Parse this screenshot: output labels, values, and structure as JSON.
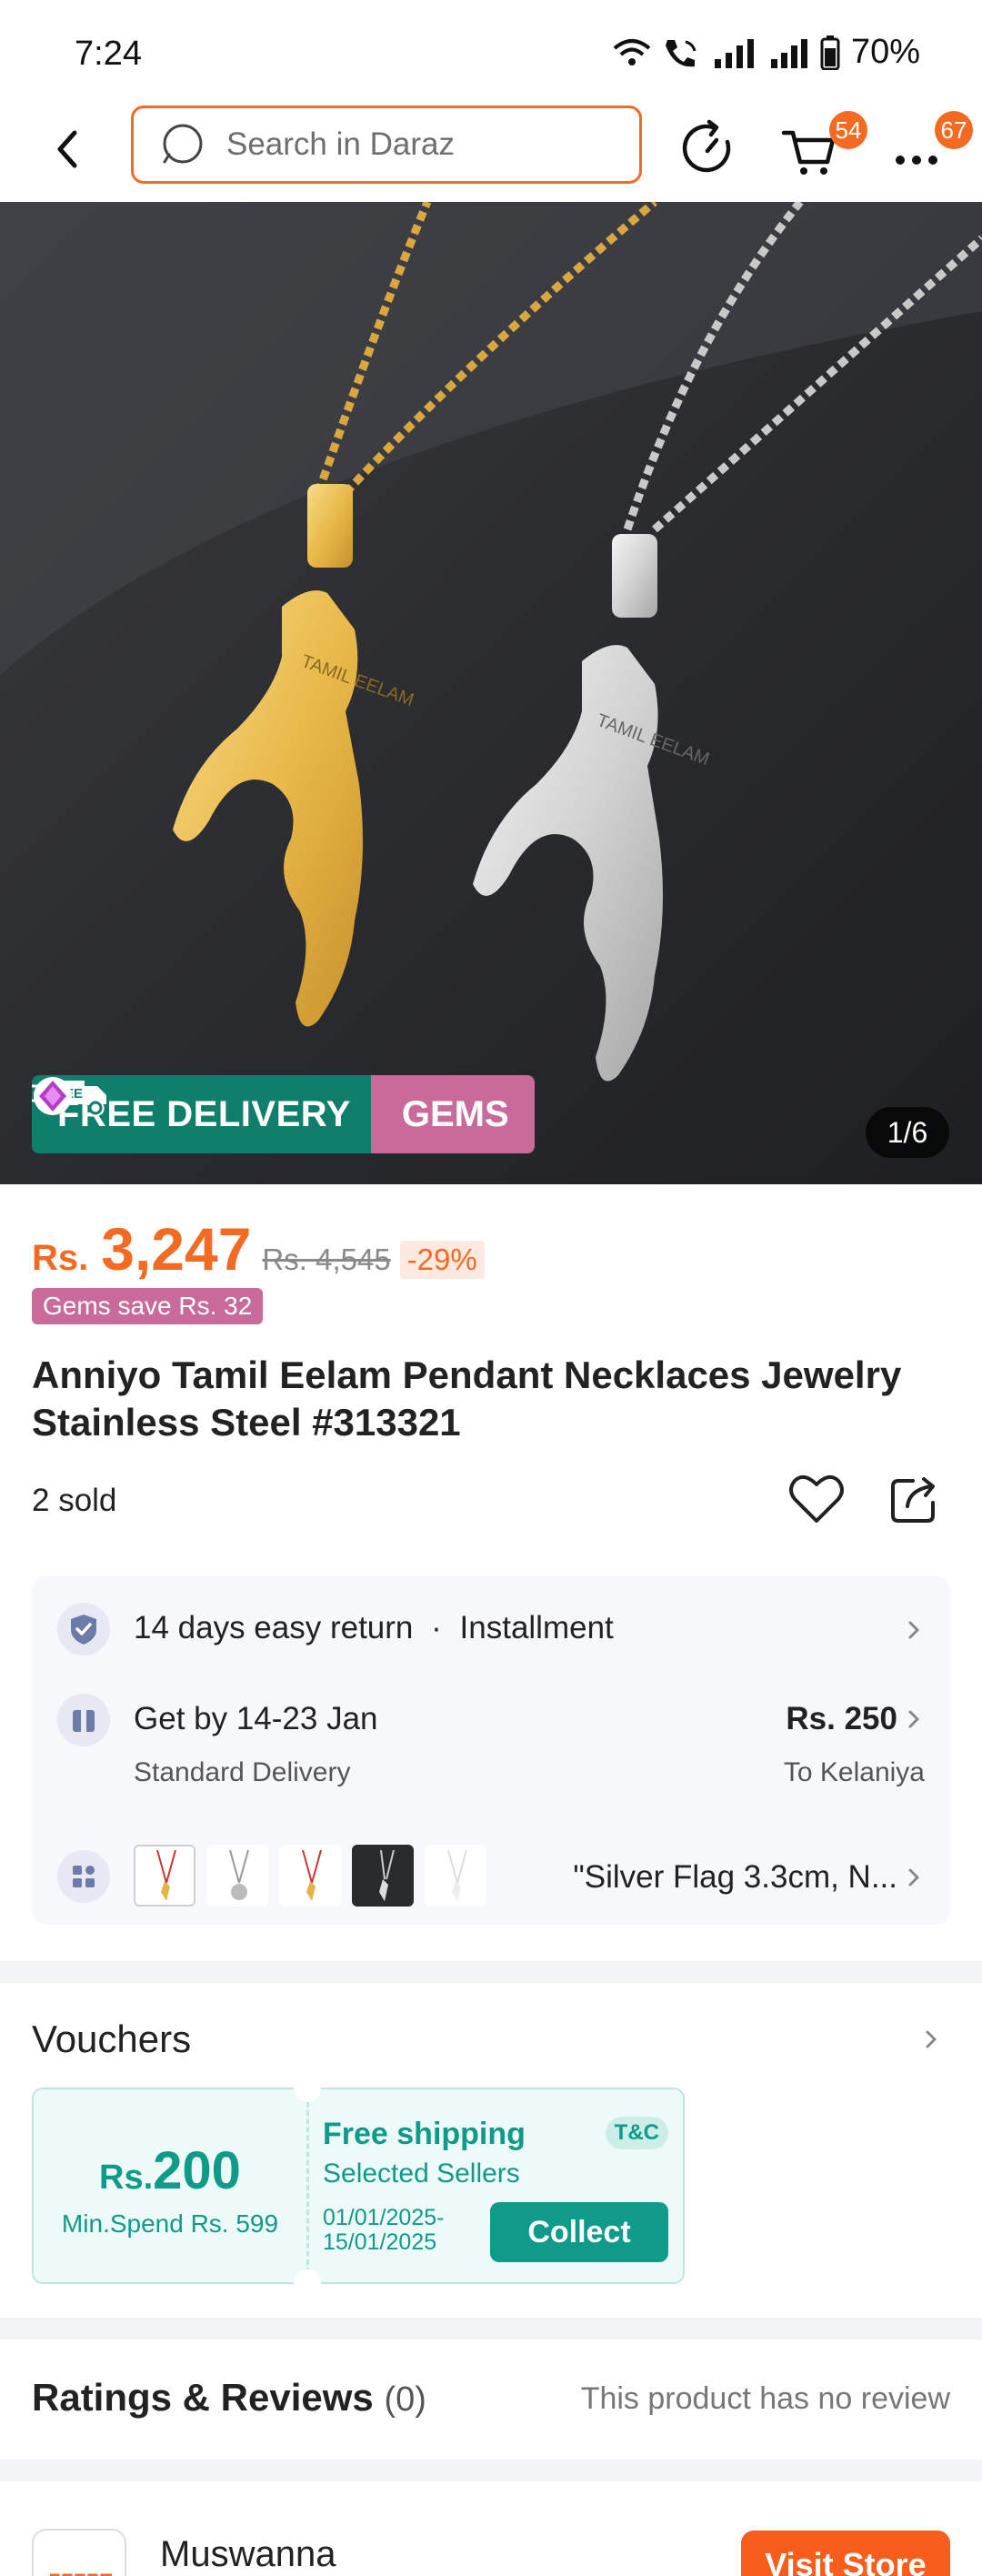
{
  "status_bar": {
    "time": "7:24",
    "battery": "70%"
  },
  "nav": {
    "search_placeholder": "Search in Daraz",
    "cart_badge": "54",
    "more_badge": "67"
  },
  "gallery": {
    "counter": "1/6",
    "promo_free_badge": "FREE",
    "promo_free": "FREE DELIVERY",
    "promo_gems": "GEMS",
    "pendant_text": "TAMIL EELAM"
  },
  "product": {
    "currency": "Rs.",
    "price": "3,247",
    "original_price": "Rs. 4,545",
    "discount": "-29%",
    "gems_save": "Gems save Rs. 32",
    "title": "Anniyo Tamil Eelam Pendant Necklaces Jewelry Stainless Steel #313321",
    "sold": "2 sold"
  },
  "info": {
    "return_text": "14 days easy return",
    "separator": "·",
    "installment": "Installment",
    "delivery_main": "Get by 14-23 Jan",
    "delivery_sub": "Standard Delivery",
    "delivery_price": "Rs. 250",
    "delivery_to": "To Kelaniya",
    "variant_label": "\"Silver Flag 3.3cm, N..."
  },
  "vouchers": {
    "title": "Vouchers",
    "amount_prefix": "Rs.",
    "amount": "200",
    "min_spend": "Min.Spend Rs. 599",
    "voucher_title": "Free shipping",
    "tc": "T&C",
    "subtitle": "Selected Sellers",
    "date": "01/01/2025-15/01/2025",
    "collect": "Collect"
  },
  "ratings": {
    "title": "Ratings & Reviews",
    "count": "(0)",
    "empty": "This product has no review"
  },
  "store": {
    "name": "Muswanna",
    "visit": "Visit Store"
  },
  "colors": {
    "accent": "#f36b23",
    "teal": "#0f9a8a",
    "gems": "#c86b9a",
    "free_delivery": "#0f7f6b"
  }
}
